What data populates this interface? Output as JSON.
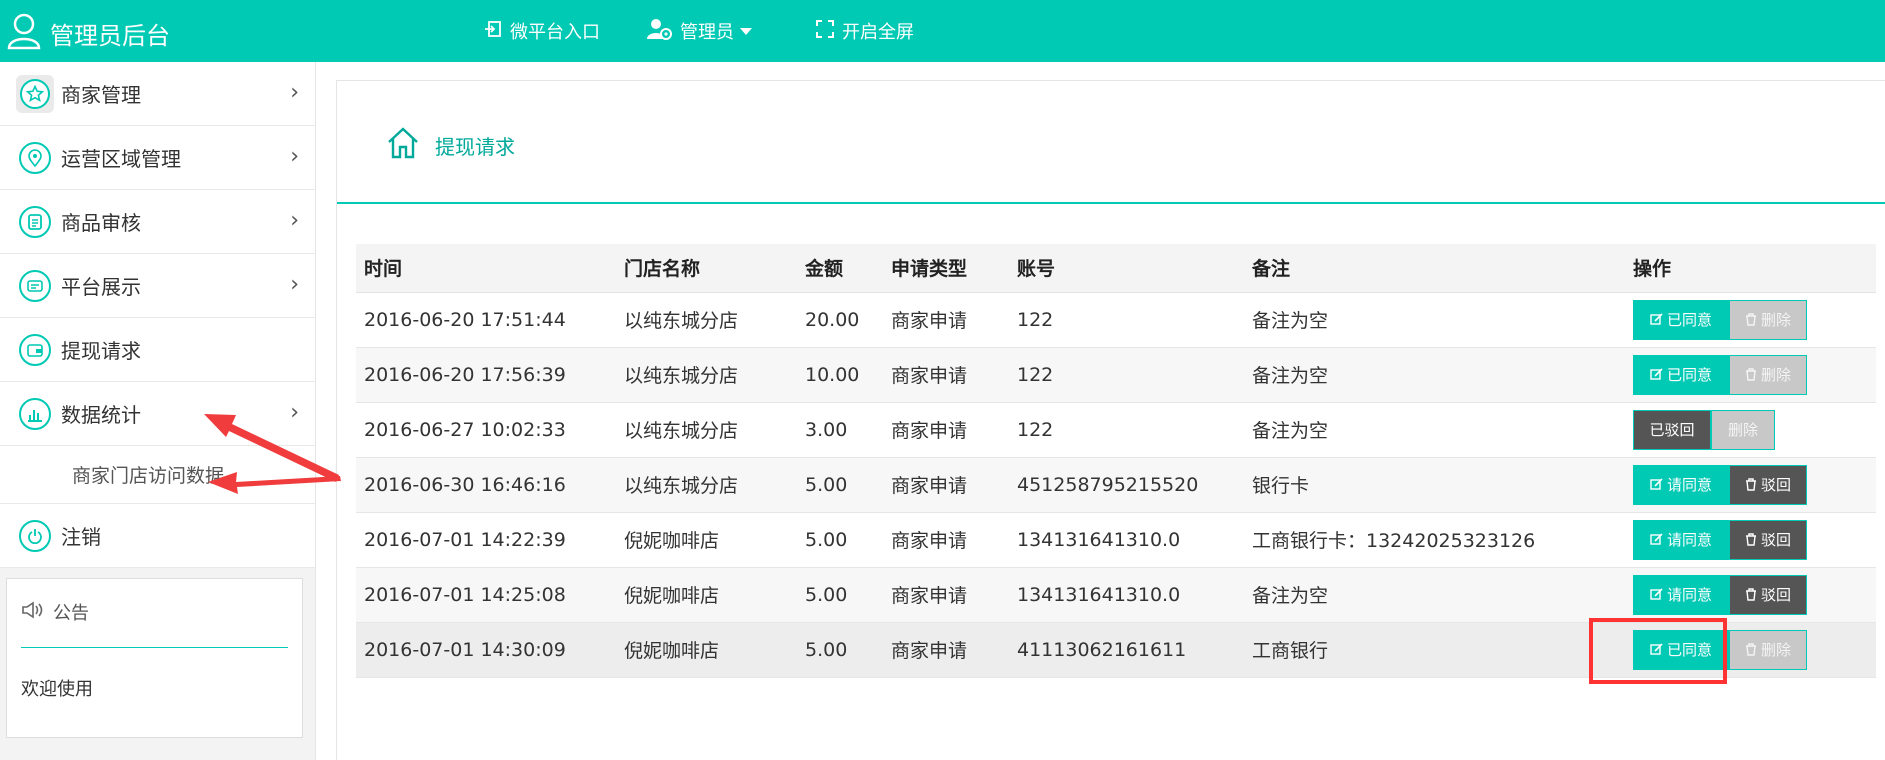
{
  "header": {
    "title": "管理员后台",
    "nav": {
      "portal": "微平台入口",
      "admin": "管理员",
      "fullscreen": "开启全屏"
    }
  },
  "sidebar": {
    "items": [
      {
        "label": "商家管理",
        "icon": "star-icon"
      },
      {
        "label": "运营区域管理",
        "icon": "location-icon"
      },
      {
        "label": "商品审核",
        "icon": "document-icon"
      },
      {
        "label": "平台展示",
        "icon": "display-icon"
      },
      {
        "label": "提现请求",
        "icon": "wallet-icon"
      },
      {
        "label": "数据统计",
        "icon": "chart-icon"
      },
      {
        "label": "注销",
        "icon": "power-icon"
      }
    ],
    "subitem": "商家门店访问数据",
    "notice": {
      "title": "公告",
      "body": "欢迎使用"
    }
  },
  "breadcrumb": {
    "title": "提现请求"
  },
  "table": {
    "headers": [
      "时间",
      "门店名称",
      "金额",
      "申请类型",
      "账号",
      "备注",
      "操作"
    ],
    "rows": [
      {
        "time": "2016-06-20 17:51:44",
        "store": "以纯东城分店",
        "amount": "20.00",
        "type": "商家申请",
        "account": "122",
        "note": "备注为空",
        "actions": [
          "已同意",
          "删除"
        ]
      },
      {
        "time": "2016-06-20 17:56:39",
        "store": "以纯东城分店",
        "amount": "10.00",
        "type": "商家申请",
        "account": "122",
        "note": "备注为空",
        "actions": [
          "已同意",
          "删除"
        ]
      },
      {
        "time": "2016-06-27 10:02:33",
        "store": "以纯东城分店",
        "amount": "3.00",
        "type": "商家申请",
        "account": "122",
        "note": "备注为空",
        "actions": [
          "已驳回",
          "删除"
        ]
      },
      {
        "time": "2016-06-30 16:46:16",
        "store": "以纯东城分店",
        "amount": "5.00",
        "type": "商家申请",
        "account": "451258795215520",
        "note": "银行卡",
        "actions": [
          "请同意",
          "驳回"
        ]
      },
      {
        "time": "2016-07-01 14:22:39",
        "store": "倪妮咖啡店",
        "amount": "5.00",
        "type": "商家申请",
        "account": "134131641310.0",
        "note": "工商银行卡：13242025323126",
        "actions": [
          "请同意",
          "驳回"
        ]
      },
      {
        "time": "2016-07-01 14:25:08",
        "store": "倪妮咖啡店",
        "amount": "5.00",
        "type": "商家申请",
        "account": "134131641310.0",
        "note": "备注为空",
        "actions": [
          "请同意",
          "驳回"
        ]
      },
      {
        "time": "2016-07-01 14:30:09",
        "store": "倪妮咖啡店",
        "amount": "5.00",
        "type": "商家申请",
        "account": "41113062161611",
        "note": "工商银行",
        "actions": [
          "已同意",
          "删除"
        ]
      }
    ]
  },
  "colors": {
    "accent": "#00c9b4",
    "dark": "#555555",
    "muted": "#c8c8c8",
    "annotation": "#ff3333"
  }
}
